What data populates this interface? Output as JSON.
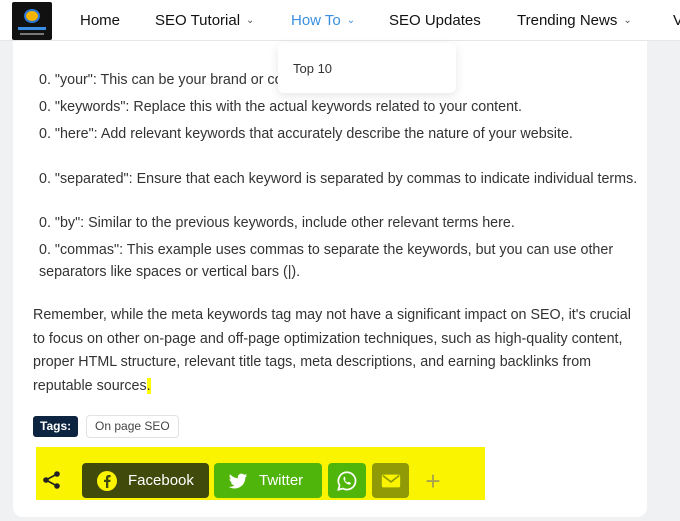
{
  "nav": {
    "items": [
      {
        "label": "Home",
        "has_dropdown": false
      },
      {
        "label": "SEO Tutorial",
        "has_dropdown": true
      },
      {
        "label": "How To",
        "has_dropdown": true,
        "active": true
      },
      {
        "label": "SEO Updates",
        "has_dropdown": false
      },
      {
        "label": "Trending News",
        "has_dropdown": true
      },
      {
        "label": "V",
        "has_dropdown": false
      }
    ],
    "dropdown_items": [
      "Top 10"
    ]
  },
  "content": {
    "list_items": [
      "0. \"your\": This can be your brand or company name.",
      "0. \"keywords\": Replace this with the actual keywords related to your content.",
      "0. \"here\": Add relevant keywords that accurately describe the nature of your website.",
      "0. \"separated\": Ensure that each keyword is separated by commas to indicate individual terms.",
      "0. \"by\": Similar to the previous keywords, include other relevant terms here.",
      "0. \"commas\": This example uses commas to separate the keywords, but you can use other separators like spaces or vertical bars (|)."
    ],
    "paragraph": "Remember, while the meta keywords tag may not have a significant impact on SEO, it's crucial to focus on other on-page and off-page optimization techniques, such as high-quality content, proper HTML structure, relevant title tags, meta descriptions, and earning backlinks from reputable sources",
    "paragraph_end": "."
  },
  "tags": {
    "label": "Tags:",
    "items": [
      "On page SEO"
    ]
  },
  "share": {
    "facebook": "Facebook",
    "twitter": "Twitter",
    "plus": "+"
  },
  "colors": {
    "active_nav": "#3a8fe0",
    "highlight": "#fbf400",
    "tags_label_bg": "#0d2440",
    "twitter_bg": "#50b50b"
  }
}
